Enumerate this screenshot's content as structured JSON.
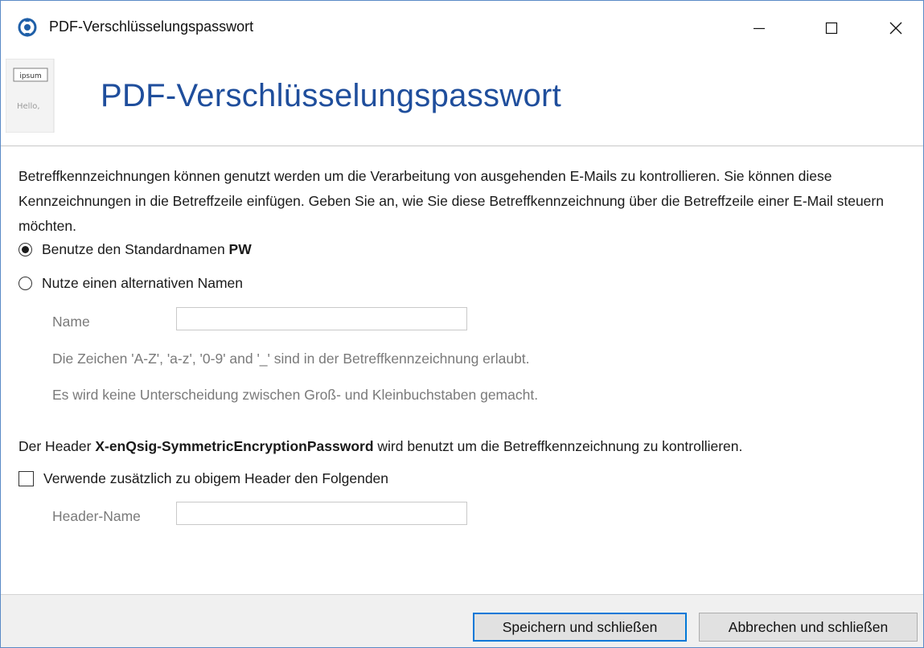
{
  "window": {
    "title": "PDF-Verschlüsselungspasswort"
  },
  "header": {
    "title": "PDF-Verschlüsselungspasswort",
    "image_text_1": "ipsum",
    "image_text_2": "Hello,"
  },
  "content": {
    "description": "Betreffkennzeichnungen können genutzt werden um die Verarbeitung von ausgehenden E-Mails zu kontrollieren. Sie können diese Kennzeichnungen in die Betreffzeile einfügen. Geben Sie an, wie Sie diese Betreffkennzeichnung über die Betreffzeile einer E-Mail steuern möchten.",
    "radio_default": {
      "label_prefix": "Benutze den Standardnamen ",
      "label_bold": "PW",
      "checked": true
    },
    "radio_alternative": {
      "label": "Nutze einen alternativen Namen",
      "checked": false
    },
    "name_field": {
      "label": "Name",
      "value": ""
    },
    "hint_chars": "Die Zeichen 'A-Z', 'a-z', '0-9' and '_' sind in der Betreffkennzeichnung erlaubt.",
    "hint_case": "Es wird keine Unterscheidung zwischen Groß- und Kleinbuchstaben gemacht.",
    "header_note": {
      "prefix": "Der Header ",
      "bold": "X-enQsig-SymmetricEncryptionPassword",
      "suffix": " wird benutzt um die Betreffkennzeichnung zu kontrollieren."
    },
    "checkbox_additional": {
      "label": "Verwende zusätzlich zu obigem Header den Folgenden",
      "checked": false
    },
    "header_name_field": {
      "label": "Header-Name",
      "value": ""
    }
  },
  "footer": {
    "save_label": "Speichern und schließen",
    "cancel_label": "Abbrechen und schließen"
  },
  "colors": {
    "header_title": "#1f4e9c",
    "window_border": "#5a8ac6",
    "default_button_border": "#0078d7",
    "footer_background": "#f0f0f0"
  }
}
